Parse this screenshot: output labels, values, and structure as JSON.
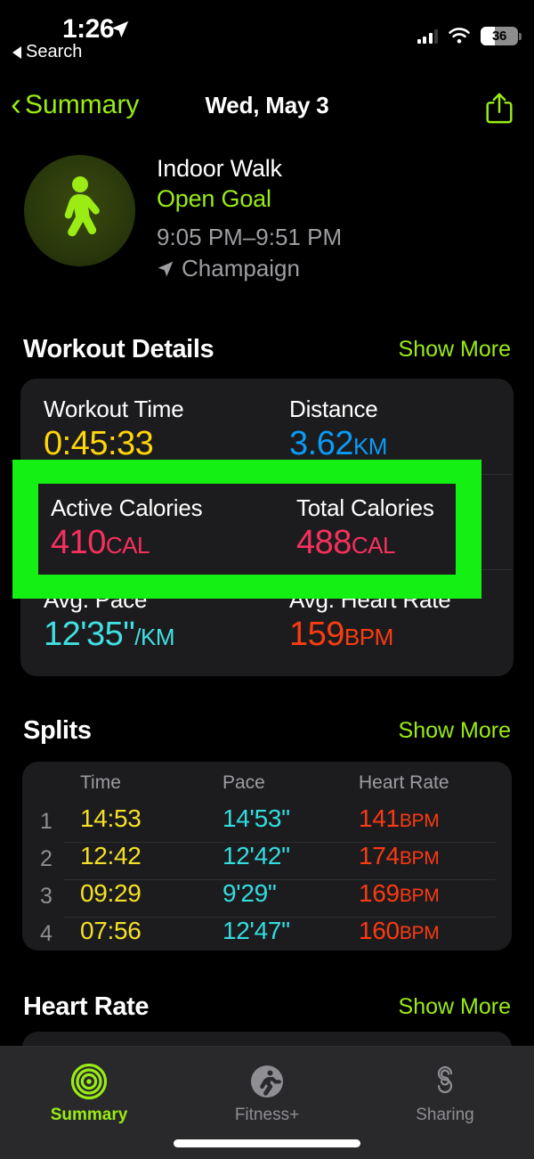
{
  "status_bar": {
    "time": "1:26",
    "back_label": "Search",
    "battery_percent": "36",
    "location_arrow_icon": "location-arrow-icon",
    "cellular_icon": "cellular-bars-icon",
    "wifi_icon": "wifi-icon"
  },
  "nav": {
    "back_label": "Summary",
    "title": "Wed, May 3",
    "share_icon": "share-icon"
  },
  "workout": {
    "icon": "walking-figure-icon",
    "title": "Indoor Walk",
    "goal": "Open Goal",
    "time_range": "9:05 PM–9:51 PM",
    "location": "Champaign",
    "location_icon": "location-arrow-icon"
  },
  "details_section": {
    "title": "Workout Details",
    "show_more": "Show More",
    "metrics": [
      {
        "label": "Workout Time",
        "value": "0:45:33",
        "unit": "",
        "color": "c-yellow"
      },
      {
        "label": "Distance",
        "value": "3.62",
        "unit": "KM",
        "color": "c-blue"
      },
      {
        "label": "Active Calories",
        "value": "410",
        "unit": "CAL",
        "color": "c-pink"
      },
      {
        "label": "Total Calories",
        "value": "488",
        "unit": "CAL",
        "color": "c-pink"
      },
      {
        "label": "Avg. Pace",
        "value": "12'35\"",
        "unit": "/KM",
        "color": "c-cyan"
      },
      {
        "label": "Avg. Heart Rate",
        "value": "159",
        "unit": "BPM",
        "color": "c-red"
      }
    ]
  },
  "annotation": {
    "color": "#14ef14",
    "target": "active-and-total-calories-row"
  },
  "splits_section": {
    "title": "Splits",
    "show_more": "Show More",
    "columns": [
      "Time",
      "Pace",
      "Heart Rate"
    ],
    "rows": [
      {
        "index": "1",
        "time": "14:53",
        "pace": "14'53\"",
        "hr": "141",
        "hr_unit": "BPM"
      },
      {
        "index": "2",
        "time": "12:42",
        "pace": "12'42\"",
        "hr": "174",
        "hr_unit": "BPM"
      },
      {
        "index": "3",
        "time": "09:29",
        "pace": "9'29\"",
        "hr": "169",
        "hr_unit": "BPM"
      },
      {
        "index": "4",
        "time": "07:56",
        "pace": "12'47\"",
        "hr": "160",
        "hr_unit": "BPM"
      }
    ]
  },
  "heart_rate_section": {
    "title": "Heart Rate",
    "show_more": "Show More"
  },
  "tab_bar": {
    "items": [
      {
        "label": "Summary",
        "icon": "activity-rings-icon",
        "active": true
      },
      {
        "label": "Fitness+",
        "icon": "running-figure-icon",
        "active": false
      },
      {
        "label": "Sharing",
        "icon": "sharing-s-icon",
        "active": false
      }
    ]
  }
}
